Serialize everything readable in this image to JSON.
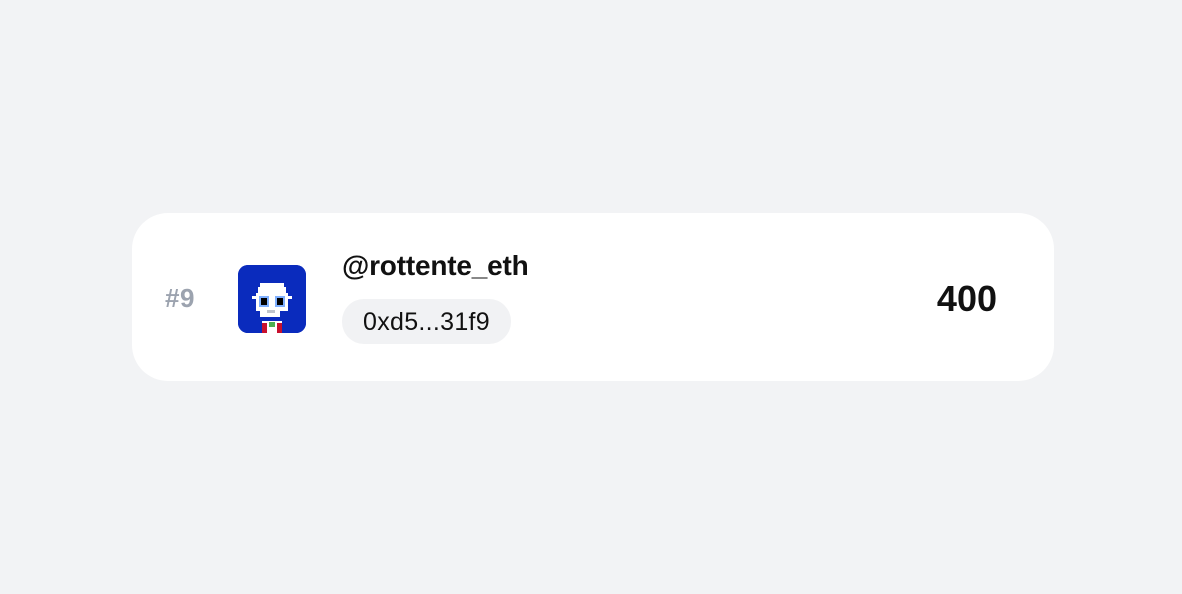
{
  "leaderboard_entry": {
    "rank": "#9",
    "username": "@rottente_eth",
    "wallet_address": "0xd5...31f9",
    "score": "400",
    "avatar": {
      "icon": "pixel-avatar-icon",
      "background_color": "#0a2bbd"
    }
  }
}
